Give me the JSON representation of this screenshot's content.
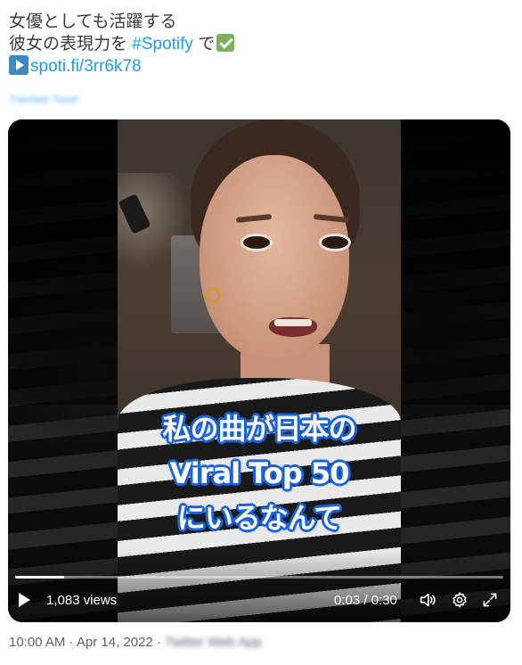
{
  "tweet": {
    "line1": "女優としても活躍する",
    "line2_text": "彼女の表現力を ",
    "hashtag": "#Spotify",
    "line2_after": " で",
    "link": "spoti.fi/3rr6k78",
    "translate_label": "Translate Tweet"
  },
  "video": {
    "caption_lines": [
      "私の曲が日本の",
      "Viral Top 50",
      "にいるなんて"
    ],
    "views": "1,083 views",
    "time": "0:03 / 0:30",
    "progress_fraction": 0.1
  },
  "meta": {
    "timestamp": "10:00 AM · Apr 14, 2022 ·",
    "source": "Twitter Web App"
  },
  "colors": {
    "link": "#1d9bf0",
    "caption_outline": "#1a64d8"
  },
  "icons": [
    "check-mark-emoji-icon",
    "play-button-emoji-icon",
    "play-icon",
    "volume-icon",
    "settings-gear-icon",
    "fullscreen-icon"
  ]
}
